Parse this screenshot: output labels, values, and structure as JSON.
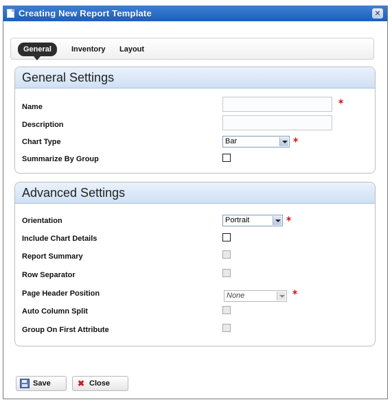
{
  "window": {
    "title": "Creating New Report Template",
    "close_symbol": "✕"
  },
  "tabs": [
    {
      "label": "General",
      "active": true
    },
    {
      "label": "Inventory",
      "active": false
    },
    {
      "label": "Layout",
      "active": false
    }
  ],
  "general": {
    "title": "General Settings",
    "name_label": "Name",
    "name_value": "",
    "description_label": "Description",
    "description_value": "",
    "chart_type_label": "Chart Type",
    "chart_type_value": "Bar",
    "summarize_label": "Summarize By Group",
    "summarize_checked": false
  },
  "advanced": {
    "title": "Advanced Settings",
    "orientation_label": "Orientation",
    "orientation_value": "Portrait",
    "chart_details_label": "Include Chart Details",
    "report_summary_label": "Report Summary",
    "row_separator_label": "Row Separator",
    "page_header_label": "Page Header Position",
    "page_header_value": "None",
    "auto_split_label": "Auto Column Split",
    "group_first_label": "Group On First Attribute"
  },
  "buttons": {
    "save": "Save",
    "close": "Close"
  },
  "icons": {
    "required": "required-marker-icon",
    "close_x": "✖"
  },
  "colors": {
    "titlebar": "#1d5fb8",
    "required": "#d21f1f",
    "panel_header": "#cfe0f4"
  }
}
